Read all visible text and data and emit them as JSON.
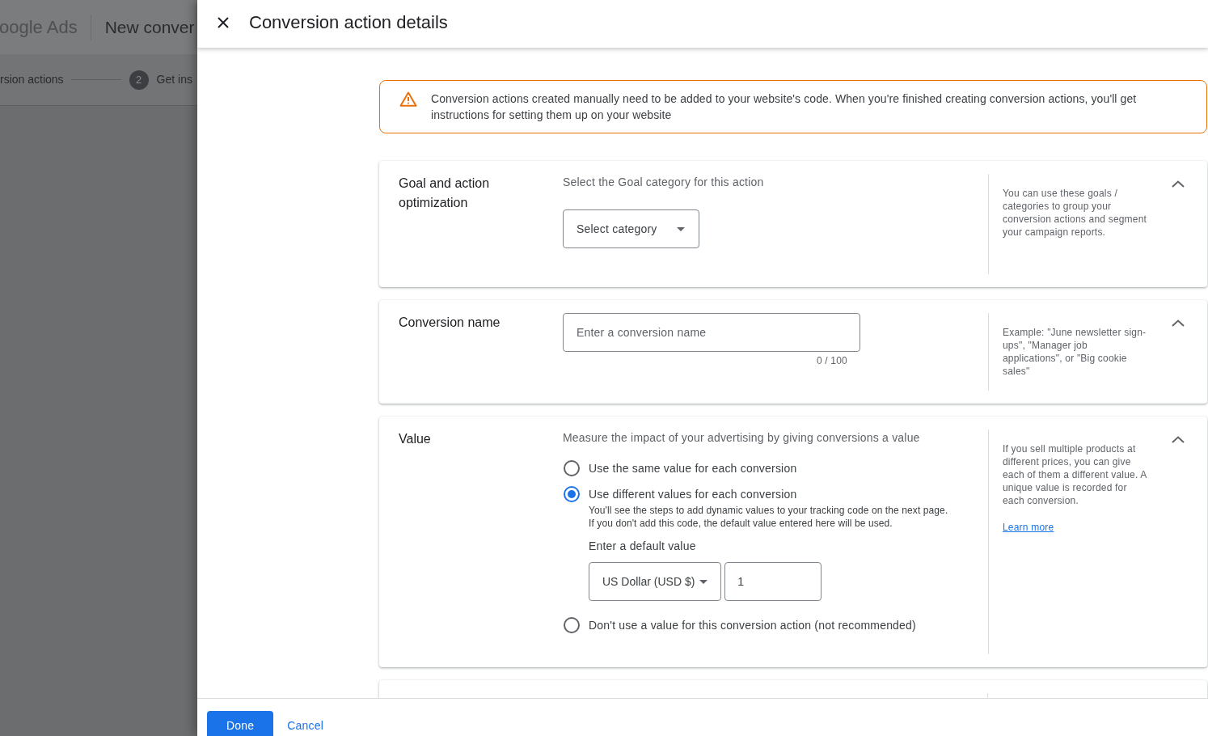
{
  "background": {
    "logo": "oogle Ads",
    "title": "New conver",
    "steps": [
      {
        "label": "rsion actions"
      },
      {
        "number": "2",
        "label": "Get ins"
      }
    ]
  },
  "panel": {
    "title": "Conversion action details",
    "notice": "Conversion actions created manually need to be added to your website's code. When you're finished creating conversion actions, you'll get instructions for setting them up on your website",
    "sections": [
      {
        "kind": "select",
        "title": "Goal and action optimization",
        "expanded": true,
        "description": "Select the Goal category for this action",
        "field": {
          "placeholder": "Select category"
        },
        "help": "You can use these goals / categories to group your conversion actions and segment your campaign reports."
      },
      {
        "kind": "text_input",
        "title": "Conversion name",
        "expanded": true,
        "field": {
          "placeholder": "Enter a conversion name",
          "counter": "0 / 100"
        },
        "help": "Example: \"June newsletter sign-ups\", \"Manager job applications\", or \"Big cookie sales\""
      },
      {
        "kind": "radio_group",
        "title": "Value",
        "expanded": true,
        "description": "Measure the impact of your advertising by giving conversions a value",
        "options": [
          {
            "label": "Use the same value for each conversion",
            "selected": false
          },
          {
            "label": "Use different values for each conversion",
            "selected": true,
            "details": "You'll see the steps to add dynamic values to your tracking code on the next page. If you don't add this code, the default value entered here will be used.",
            "default_value": {
              "label": "Enter a default value",
              "currency": "US Dollar (USD $)",
              "value": "1"
            }
          },
          {
            "label": "Don't use a value for this conversion action (not recommended)",
            "selected": false
          }
        ],
        "help": "If you sell multiple products at different prices, you can give each of them a different value. A unique value is recorded for each conversion.",
        "link": "Learn more"
      }
    ],
    "buttons": [
      {
        "label": "Done",
        "kind": "primary"
      },
      {
        "label": "Cancel",
        "kind": "text"
      }
    ]
  }
}
